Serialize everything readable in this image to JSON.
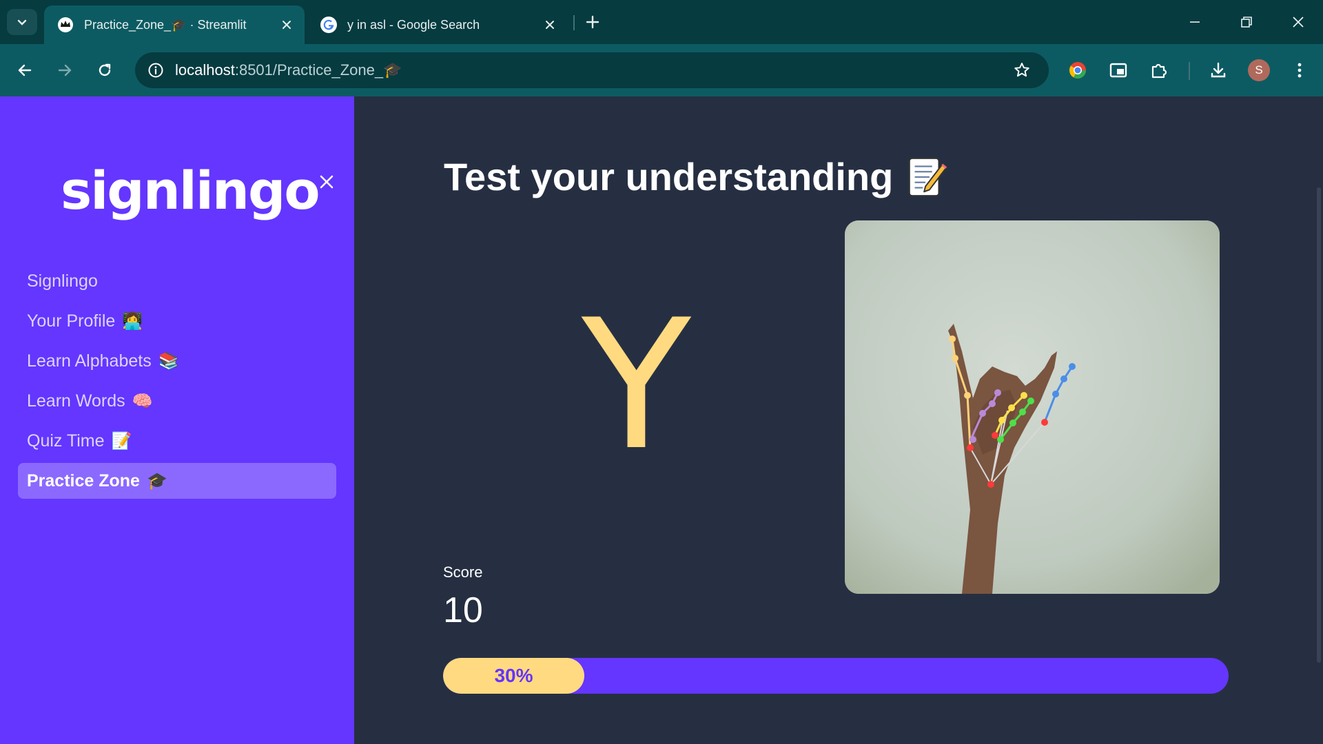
{
  "browser": {
    "tabs": [
      {
        "title": "Practice_Zone_🎓 · Streamlit",
        "favicon": "streamlit-crown-icon",
        "active": true
      },
      {
        "title": "y in asl - Google Search",
        "favicon": "google-icon",
        "active": false
      }
    ],
    "url_host": "localhost",
    "url_path": ":8501/Practice_Zone_🎓",
    "profile_initial": "S",
    "colors": {
      "tabbar": "#063b40",
      "toolbar": "#0d5b62"
    }
  },
  "sidebar": {
    "logo": "signlingo",
    "items": [
      {
        "label": "Signlingo",
        "emoji": ""
      },
      {
        "label": "Your Profile",
        "emoji": "👩‍💻"
      },
      {
        "label": "Learn Alphabets",
        "emoji": "📚"
      },
      {
        "label": "Learn Words",
        "emoji": "🧠"
      },
      {
        "label": "Quiz Time",
        "emoji": "📝"
      },
      {
        "label": "Practice Zone",
        "emoji": "🎓"
      }
    ],
    "active_index": 5,
    "colors": {
      "background": "#6436ff",
      "active": "#8b69ff"
    }
  },
  "main": {
    "heading": "Test your understanding",
    "heading_emoji": "memo-icon",
    "letter": "Y",
    "score_label": "Score",
    "score_value": "10",
    "progress": {
      "fraction": 0.3,
      "label": "30%"
    },
    "colors": {
      "accent": "#ffda80",
      "background": "#262f42"
    }
  }
}
